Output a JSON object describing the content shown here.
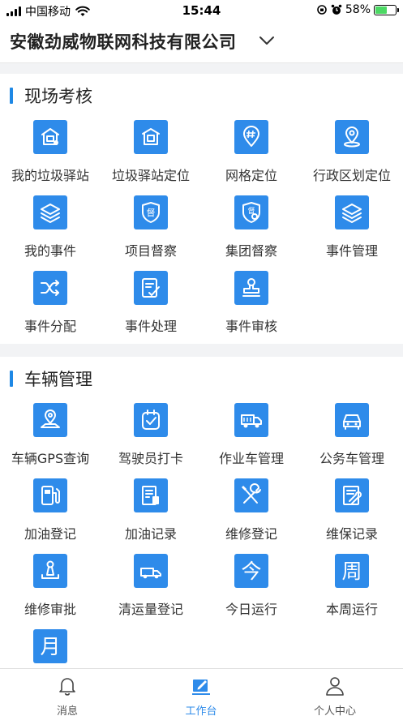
{
  "status_bar": {
    "carrier": "中国移动",
    "time": "15:44",
    "battery": "58%",
    "battery_level": 0.58
  },
  "header": {
    "company": "安徽劲威物联网科技有限公司"
  },
  "sections": [
    {
      "title": "现场考核",
      "items": [
        {
          "label": "我的垃圾驿站",
          "icon": "trash-station-icon"
        },
        {
          "label": "垃圾驿站定位",
          "icon": "station-locate-icon"
        },
        {
          "label": "网格定位",
          "icon": "grid-location-icon"
        },
        {
          "label": "行政区划定位",
          "icon": "region-location-icon"
        },
        {
          "label": "我的事件",
          "icon": "layers-icon"
        },
        {
          "label": "项目督察",
          "icon": "inspection-shield-icon"
        },
        {
          "label": "集团督察",
          "icon": "group-inspection-icon"
        },
        {
          "label": "事件管理",
          "icon": "layers-icon"
        },
        {
          "label": "事件分配",
          "icon": "shuffle-icon"
        },
        {
          "label": "事件处理",
          "icon": "edit-document-icon"
        },
        {
          "label": "事件审核",
          "icon": "stamp-icon"
        }
      ]
    },
    {
      "title": "车辆管理",
      "items": [
        {
          "label": "车辆GPS查询",
          "icon": "gps-map-icon"
        },
        {
          "label": "驾驶员打卡",
          "icon": "check-in-icon"
        },
        {
          "label": "作业车管理",
          "icon": "garbage-truck-icon"
        },
        {
          "label": "公务车管理",
          "icon": "car-icon"
        },
        {
          "label": "加油登记",
          "icon": "fuel-pump-icon"
        },
        {
          "label": "加油记录",
          "icon": "fuel-record-icon"
        },
        {
          "label": "维修登记",
          "icon": "repair-tools-icon"
        },
        {
          "label": "维保记录",
          "icon": "maintenance-record-icon"
        },
        {
          "label": "维修审批",
          "icon": "joystick-icon"
        },
        {
          "label": "清运量登记",
          "icon": "truck-icon"
        },
        {
          "label": "今日运行",
          "icon": "today-icon",
          "glyph": "今"
        },
        {
          "label": "本周运行",
          "icon": "week-icon",
          "glyph": "周"
        },
        {
          "label": "",
          "icon": "month-icon",
          "glyph": "月"
        }
      ]
    }
  ],
  "tabbar": [
    {
      "label": "消息",
      "icon": "bell-icon",
      "active": false
    },
    {
      "label": "工作台",
      "icon": "workbench-icon",
      "active": true
    },
    {
      "label": "个人中心",
      "icon": "person-icon",
      "active": false
    }
  ],
  "colors": {
    "accent": "#2e8bea",
    "section_bar": "#1e88e5"
  }
}
